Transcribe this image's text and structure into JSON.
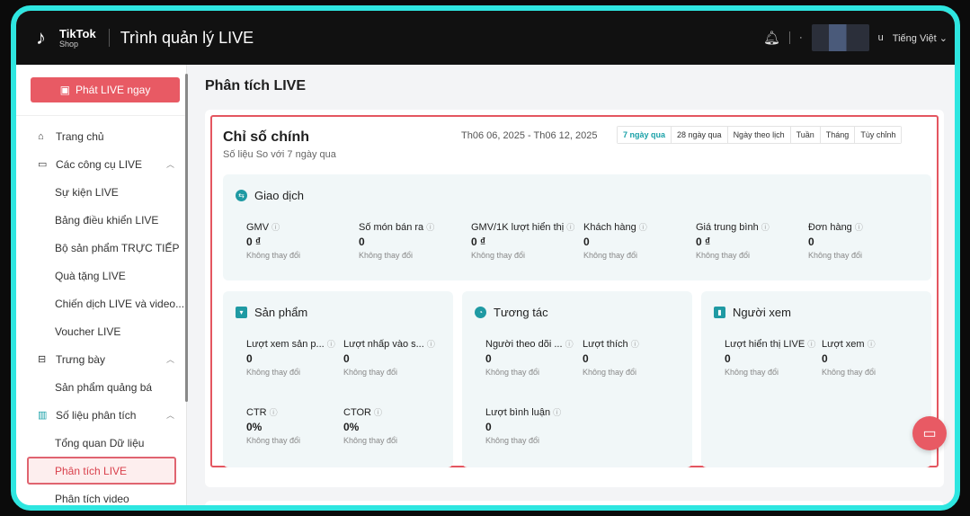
{
  "topbar": {
    "logo_brand": "TikTok",
    "logo_sub": "Shop",
    "app_title": "Trình quản lý LIVE",
    "language": "Tiếng Việt",
    "user_suffix": "u"
  },
  "sidebar": {
    "live_button": "Phát LIVE ngay",
    "items": [
      {
        "label": "Trang chủ",
        "type": "group",
        "icon": "home-icon"
      },
      {
        "label": "Các công cụ LIVE",
        "type": "group",
        "icon": "live-tools-icon",
        "expanded": true
      },
      {
        "label": "Sự kiện LIVE",
        "type": "sub"
      },
      {
        "label": "Bảng điều khiển LIVE",
        "type": "sub"
      },
      {
        "label": "Bộ sản phẩm TRỰC TIẾP",
        "type": "sub"
      },
      {
        "label": "Quà tặng LIVE",
        "type": "sub"
      },
      {
        "label": "Chiến dịch LIVE và video...",
        "type": "sub"
      },
      {
        "label": "Voucher LIVE",
        "type": "sub"
      },
      {
        "label": "Trưng bày",
        "type": "group",
        "icon": "showcase-icon",
        "expanded": true
      },
      {
        "label": "Sản phẩm quảng bá",
        "type": "sub"
      },
      {
        "label": "Số liệu phân tích",
        "type": "group",
        "icon": "analytics-icon",
        "expanded": true
      },
      {
        "label": "Tổng quan Dữ liệu",
        "type": "sub"
      },
      {
        "label": "Phân tích LIVE",
        "type": "sub",
        "active": true
      },
      {
        "label": "Phân tích video",
        "type": "sub"
      }
    ]
  },
  "main": {
    "page_title": "Phân tích LIVE",
    "section_title": "Chỉ số chính",
    "section_subtitle": "Số liệu So với 7 ngày qua",
    "date_range": "Th06 06, 2025 - Th06 12, 2025",
    "tabs": [
      "7 ngày qua",
      "28 ngày qua",
      "Ngày theo lịch",
      "Tuần",
      "Tháng",
      "Tùy chỉnh"
    ],
    "active_tab": "7 ngày qua",
    "transactions": {
      "title": "Giao dịch",
      "metrics": [
        {
          "label": "GMV",
          "value": "0 ₫",
          "change": "Không thay đổi"
        },
        {
          "label": "Số món bán ra",
          "value": "0",
          "change": "Không thay đổi"
        },
        {
          "label": "GMV/1K lượt hiển thị",
          "value": "0 ₫",
          "change": "Không thay đổi"
        },
        {
          "label": "Khách hàng",
          "value": "0",
          "change": "Không thay đổi"
        },
        {
          "label": "Giá trung bình",
          "value": "0 ₫",
          "change": "Không thay đổi"
        },
        {
          "label": "Đơn hàng",
          "value": "0",
          "change": "Không thay đổi"
        }
      ]
    },
    "products": {
      "title": "Sản phẩm",
      "metrics": [
        {
          "label": "Lượt xem sản p...",
          "value": "0",
          "change": "Không thay đổi"
        },
        {
          "label": "Lượt nhấp vào s...",
          "value": "0",
          "change": "Không thay đổi"
        },
        {
          "label": "CTR",
          "value": "0%",
          "change": "Không thay đổi"
        },
        {
          "label": "CTOR",
          "value": "0%",
          "change": "Không thay đổi"
        }
      ]
    },
    "engagement": {
      "title": "Tương tác",
      "metrics": [
        {
          "label": "Người theo dõi ...",
          "value": "0",
          "change": "Không thay đổi"
        },
        {
          "label": "Lượt thích",
          "value": "0",
          "change": "Không thay đổi"
        },
        {
          "label": "Lượt bình luận",
          "value": "0",
          "change": "Không thay đổi"
        }
      ]
    },
    "viewers": {
      "title": "Người xem",
      "metrics": [
        {
          "label": "Lượt hiển thị LIVE",
          "value": "0",
          "change": "Không thay đổi"
        },
        {
          "label": "Lượt xem",
          "value": "0",
          "change": "Không thay đổi"
        }
      ]
    }
  },
  "colors": {
    "accent": "#e85a64",
    "teal": "#1aa1a8",
    "frame": "#2ee6e0"
  }
}
